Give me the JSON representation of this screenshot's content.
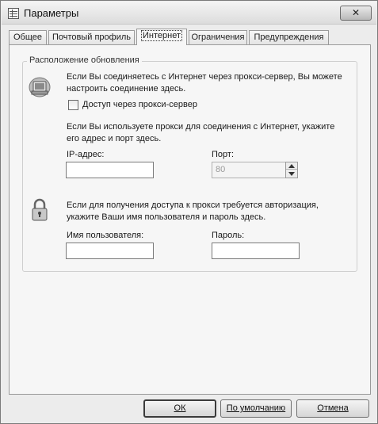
{
  "window": {
    "title": "Параметры",
    "close_label": "✕"
  },
  "tabs": [
    {
      "label": "Общее"
    },
    {
      "label": "Почтовый профиль"
    },
    {
      "label": "Интернет"
    },
    {
      "label": "Ограничения"
    },
    {
      "label": "Предупреждения"
    }
  ],
  "active_tab": "Интернет",
  "group": {
    "title": "Расположение обновления"
  },
  "proxy": {
    "intro": "Если Вы соединяетесь с Интернет через прокси-сервер, Вы можете настроить соединение здесь.",
    "checkbox_label": "Доступ через прокси-сервер",
    "checkbox_checked": false,
    "address_intro": "Если Вы используете прокси для соединения с Интернет, укажите его адрес и порт здесь.",
    "ip_label": "IP-адрес:",
    "ip_value": "",
    "port_label": "Порт:",
    "port_value": "80"
  },
  "auth": {
    "intro": "Если для получения доступа к прокси требуется авторизация, укажите Ваши имя пользователя и пароль здесь.",
    "username_label": "Имя пользователя:",
    "username_value": "",
    "password_label": "Пароль:",
    "password_value": ""
  },
  "buttons": {
    "ok": "ОК",
    "defaults": "По умолчанию",
    "cancel": "Отмена"
  },
  "icons": {
    "window": "app-window-icon",
    "network": "network-computer-icon",
    "lock": "padlock-icon"
  }
}
